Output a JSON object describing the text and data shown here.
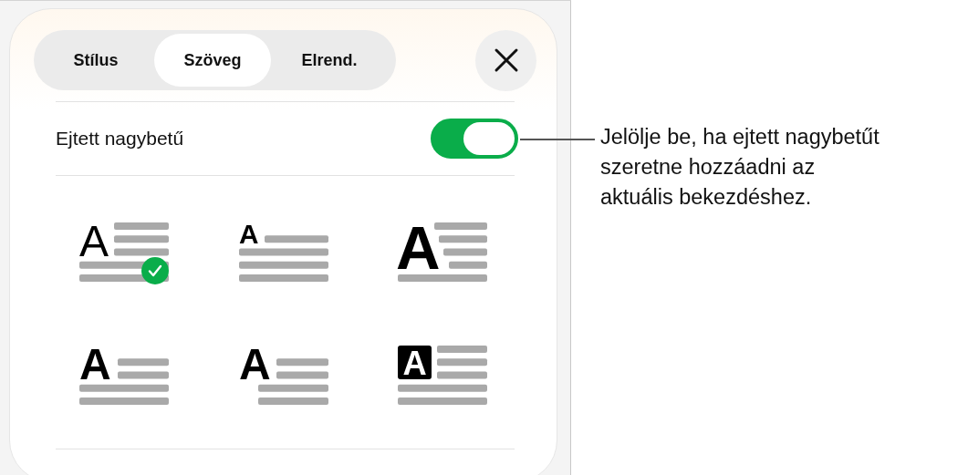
{
  "tabs": [
    {
      "label": "Stílus",
      "selected": false
    },
    {
      "label": "Szöveg",
      "selected": true
    },
    {
      "label": "Elrend.",
      "selected": false
    }
  ],
  "drop_cap": {
    "label": "Ejtett nagybetű",
    "on": true
  },
  "styles": [
    {
      "kind": "drop",
      "letter": "A",
      "selected": true
    },
    {
      "kind": "raised",
      "letter": "A",
      "selected": false
    },
    {
      "kind": "drop-large",
      "letter": "A",
      "selected": false
    },
    {
      "kind": "drop-bold",
      "letter": "A",
      "selected": false
    },
    {
      "kind": "hanging",
      "letter": "A",
      "selected": false
    },
    {
      "kind": "boxed",
      "letter": "A",
      "selected": false
    }
  ],
  "callout": {
    "lines": [
      "Jelölje be, ha ejtett nagybetűt",
      "szeretne hozzáadni az",
      "aktuális bekezdéshez."
    ]
  }
}
